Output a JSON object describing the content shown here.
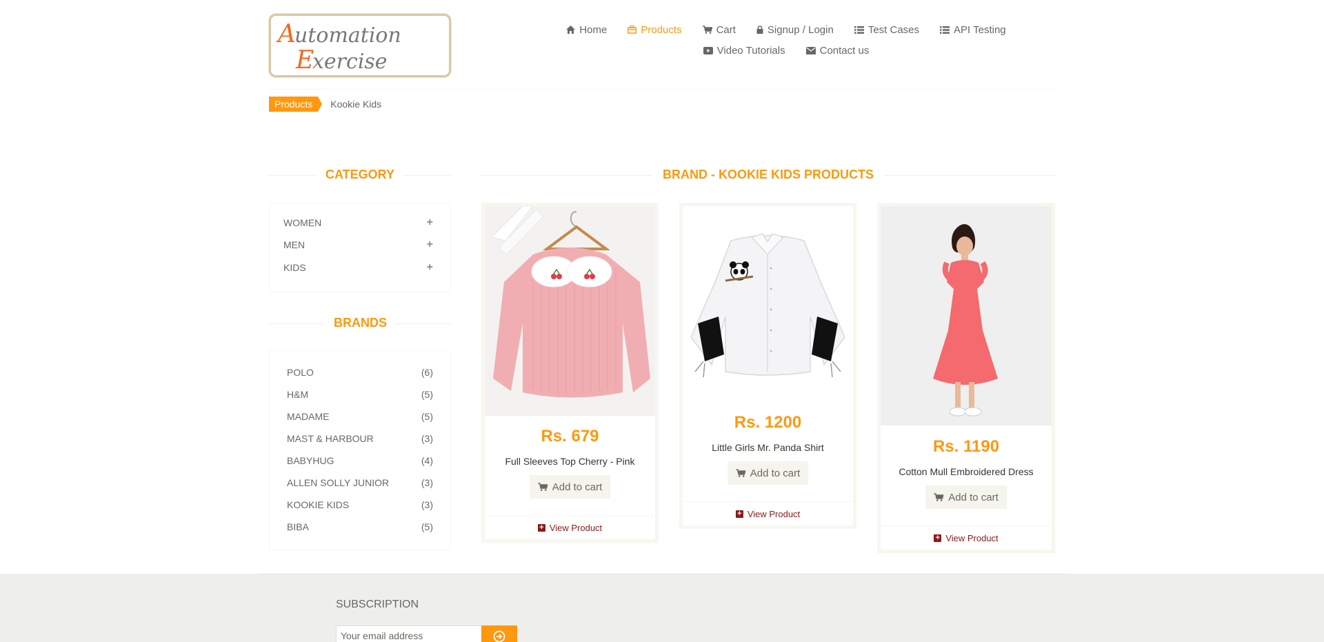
{
  "logo": {
    "line1": "Automation",
    "line2": "Exercise"
  },
  "nav": {
    "row1": [
      {
        "label": "Home",
        "icon": "home-icon"
      },
      {
        "label": "Products",
        "icon": "products-icon",
        "active": true
      },
      {
        "label": "Cart",
        "icon": "cart-icon"
      },
      {
        "label": "Signup / Login",
        "icon": "lock-icon"
      },
      {
        "label": "Test Cases",
        "icon": "list-icon"
      },
      {
        "label": "API Testing",
        "icon": "list-icon"
      }
    ],
    "row2": [
      {
        "label": "Video Tutorials",
        "icon": "youtube-icon"
      },
      {
        "label": "Contact us",
        "icon": "envelope-icon"
      }
    ]
  },
  "breadcrumb": {
    "parent": "Products",
    "current": "Kookie Kids"
  },
  "sidebar": {
    "category_title": "Category",
    "categories": [
      "Women",
      "Men",
      "Kids"
    ],
    "brands_title": "Brands",
    "brands": [
      {
        "name": "POLO",
        "count": "(6)"
      },
      {
        "name": "H&M",
        "count": "(5)"
      },
      {
        "name": "MADAME",
        "count": "(5)"
      },
      {
        "name": "MAST & HARBOUR",
        "count": "(3)"
      },
      {
        "name": "BABYHUG",
        "count": "(4)"
      },
      {
        "name": "ALLEN SOLLY JUNIOR",
        "count": "(3)"
      },
      {
        "name": "KOOKIE KIDS",
        "count": "(3)"
      },
      {
        "name": "BIBA",
        "count": "(5)"
      }
    ]
  },
  "main": {
    "title": "Brand - Kookie Kids Products",
    "products": [
      {
        "price": "Rs. 679",
        "name": "Full Sleeves Top Cherry - Pink",
        "cart_label": "Add to cart",
        "view_label": "View Product"
      },
      {
        "price": "Rs. 1200",
        "name": "Little Girls Mr. Panda Shirt",
        "cart_label": "Add to cart",
        "view_label": "View Product"
      },
      {
        "price": "Rs. 1190",
        "name": "Cotton Mull Embroidered Dress",
        "cart_label": "Add to cart",
        "view_label": "View Product"
      }
    ]
  },
  "footer": {
    "subscription_title": "Subscription",
    "email_placeholder": "Your email address"
  },
  "colors": {
    "accent": "#fe980f",
    "text": "#696763",
    "view_link": "#8b1a1a",
    "footer_bg": "#eeeeea"
  }
}
